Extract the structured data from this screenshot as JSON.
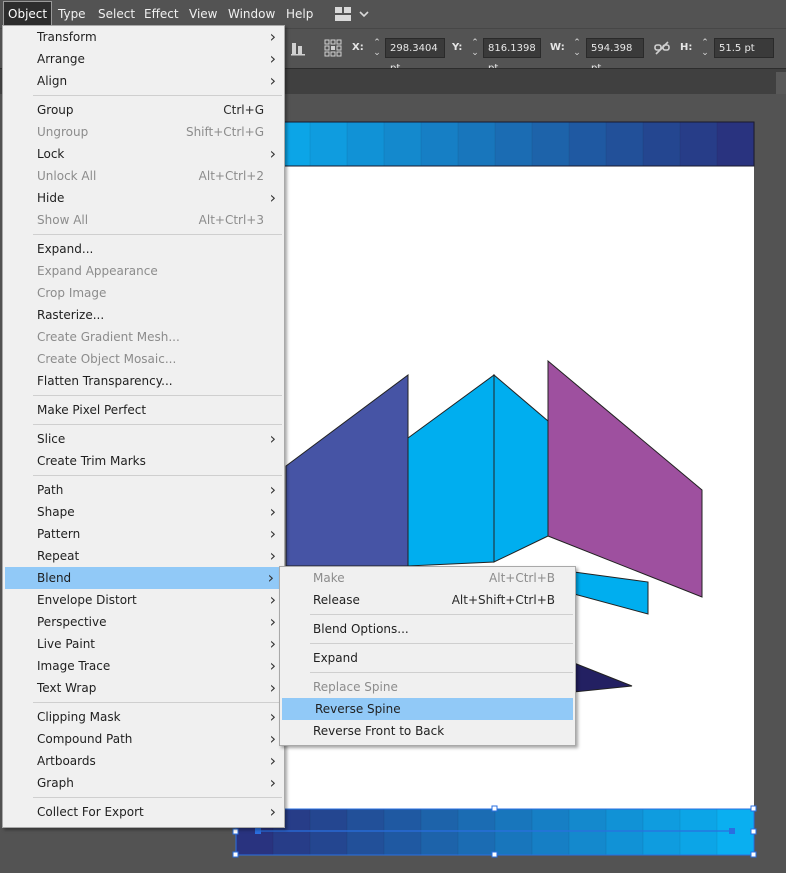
{
  "menubar": {
    "items": [
      "Object",
      "Type",
      "Select",
      "Effect",
      "View",
      "Window",
      "Help"
    ],
    "workspace_icon": "workspace-switcher-icon"
  },
  "control": {
    "x_label": "X:",
    "x_value": "298.3404 pt",
    "y_label": "Y:",
    "y_value": "816.1398 pt",
    "w_label": "W:",
    "w_value": "594.398 pt",
    "h_label": "H:",
    "h_value": "51.5 pt"
  },
  "object_menu": [
    {
      "label": "Transform",
      "sub": true
    },
    {
      "label": "Arrange",
      "sub": true
    },
    {
      "label": "Align",
      "sub": true
    },
    {
      "sep": true
    },
    {
      "label": "Group",
      "shortcut": "Ctrl+G"
    },
    {
      "label": "Ungroup",
      "shortcut": "Shift+Ctrl+G",
      "disabled": true
    },
    {
      "label": "Lock",
      "sub": true
    },
    {
      "label": "Unlock All",
      "shortcut": "Alt+Ctrl+2",
      "disabled": true
    },
    {
      "label": "Hide",
      "sub": true
    },
    {
      "label": "Show All",
      "shortcut": "Alt+Ctrl+3",
      "disabled": true
    },
    {
      "sep": true
    },
    {
      "label": "Expand..."
    },
    {
      "label": "Expand Appearance",
      "disabled": true
    },
    {
      "label": "Crop Image",
      "disabled": true
    },
    {
      "label": "Rasterize..."
    },
    {
      "label": "Create Gradient Mesh...",
      "disabled": true
    },
    {
      "label": "Create Object Mosaic...",
      "disabled": true
    },
    {
      "label": "Flatten Transparency..."
    },
    {
      "sep": true
    },
    {
      "label": "Make Pixel Perfect"
    },
    {
      "sep": true
    },
    {
      "label": "Slice",
      "sub": true
    },
    {
      "label": "Create Trim Marks"
    },
    {
      "sep": true
    },
    {
      "label": "Path",
      "sub": true
    },
    {
      "label": "Shape",
      "sub": true
    },
    {
      "label": "Pattern",
      "sub": true
    },
    {
      "label": "Repeat",
      "sub": true
    },
    {
      "label": "Blend",
      "sub": true,
      "highlight": true
    },
    {
      "label": "Envelope Distort",
      "sub": true
    },
    {
      "label": "Perspective",
      "sub": true
    },
    {
      "label": "Live Paint",
      "sub": true
    },
    {
      "label": "Image Trace",
      "sub": true
    },
    {
      "label": "Text Wrap",
      "sub": true
    },
    {
      "sep": true
    },
    {
      "label": "Clipping Mask",
      "sub": true
    },
    {
      "label": "Compound Path",
      "sub": true
    },
    {
      "label": "Artboards",
      "sub": true
    },
    {
      "label": "Graph",
      "sub": true
    },
    {
      "sep": true
    },
    {
      "label": "Collect For Export",
      "sub": true
    }
  ],
  "blend_menu": [
    {
      "label": "Make",
      "shortcut": "Alt+Ctrl+B",
      "disabled": true
    },
    {
      "label": "Release",
      "shortcut": "Alt+Shift+Ctrl+B"
    },
    {
      "sep": true
    },
    {
      "label": "Blend Options..."
    },
    {
      "sep": true
    },
    {
      "label": "Expand"
    },
    {
      "sep": true
    },
    {
      "label": "Replace Spine",
      "disabled": true
    },
    {
      "label": "Reverse Spine",
      "highlight": true
    },
    {
      "label": "Reverse Front to Back"
    }
  ],
  "colors": {
    "blend_start": "#29337f",
    "blend_end": "#0aaff0",
    "cyan_shape": "#00aeef",
    "purple_shape": "#9e509f",
    "indigo_shape": "#4654a5",
    "navy_shape": "#232062",
    "selection": "#2a6fe0",
    "highlight": "#91c9f7"
  }
}
